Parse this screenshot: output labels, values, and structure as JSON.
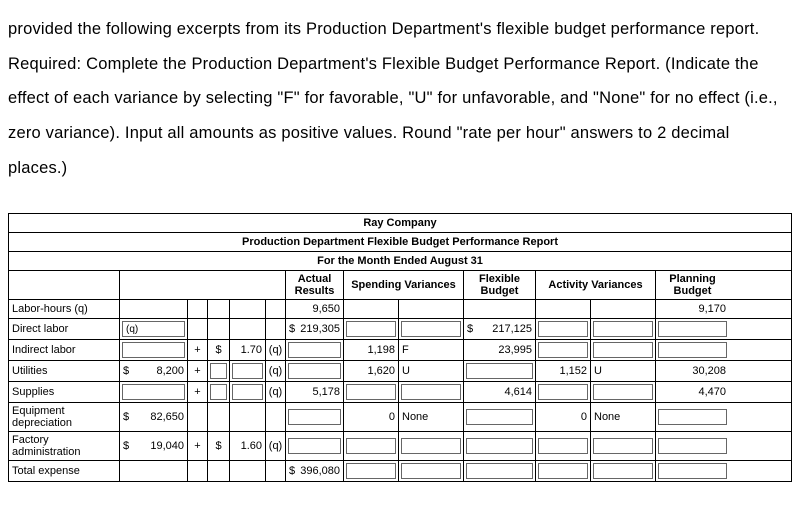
{
  "instructions": "provided the following excerpts from its Production Department's flexible budget performance report. Required: Complete the Production Department's Flexible Budget Performance Report. (Indicate the effect of each variance by selecting \"F\" for favorable, \"U\" for unfavorable, and \"None\" for no effect (i.e., zero variance). Input all amounts as positive values. Round \"rate per hour\" answers to 2 decimal places.)",
  "report": {
    "company": "Ray Company",
    "title": "Production Department Flexible Budget Performance Report",
    "period": "For the Month Ended August 31",
    "headers": {
      "actual": "Actual Results",
      "spending": "Spending Variances",
      "flexible": "Flexible Budget",
      "activity": "Activity Variances",
      "planning": "Planning Budget"
    },
    "rows": {
      "labor_hours": {
        "label": "Labor-hours (q)",
        "actual": "9,650",
        "planning": "9,170"
      },
      "direct_labor": {
        "label": "Direct labor",
        "q": "(q)",
        "actual_dollar": "$",
        "actual": "219,305",
        "flexible_dollar": "$",
        "flexible": "217,125"
      },
      "indirect_labor": {
        "label": "Indirect labor",
        "plus": "+",
        "dollar": "$",
        "rate": "1.70",
        "q": "(q)",
        "sv_amt": "1,198",
        "sv_fu": "F",
        "flexible": "23,995"
      },
      "utilities": {
        "label": "Utilities",
        "fixed_dollar": "$",
        "fixed": "8,200",
        "plus": "+",
        "q": "(q)",
        "sv_amt": "1,620",
        "sv_fu": "U",
        "av_amt": "1,152",
        "av_fu": "U",
        "planning": "30,208"
      },
      "supplies": {
        "label": "Supplies",
        "plus": "+",
        "q": "(q)",
        "actual": "5,178",
        "flexible": "4,614",
        "planning": "4,470"
      },
      "equipment_dep": {
        "label": "Equipment depreciation",
        "fixed_dollar": "$",
        "fixed": "82,650",
        "sv_amt": "0",
        "sv_fu": "None",
        "av_amt": "0",
        "av_fu": "None"
      },
      "factory_admin": {
        "label": "Factory administration",
        "fixed_dollar": "$",
        "fixed": "19,040",
        "plus": "+",
        "dollar": "$",
        "rate": "1.60",
        "q": "(q)"
      },
      "total": {
        "label": "Total expense",
        "actual_dollar": "$",
        "actual": "396,080"
      }
    }
  }
}
